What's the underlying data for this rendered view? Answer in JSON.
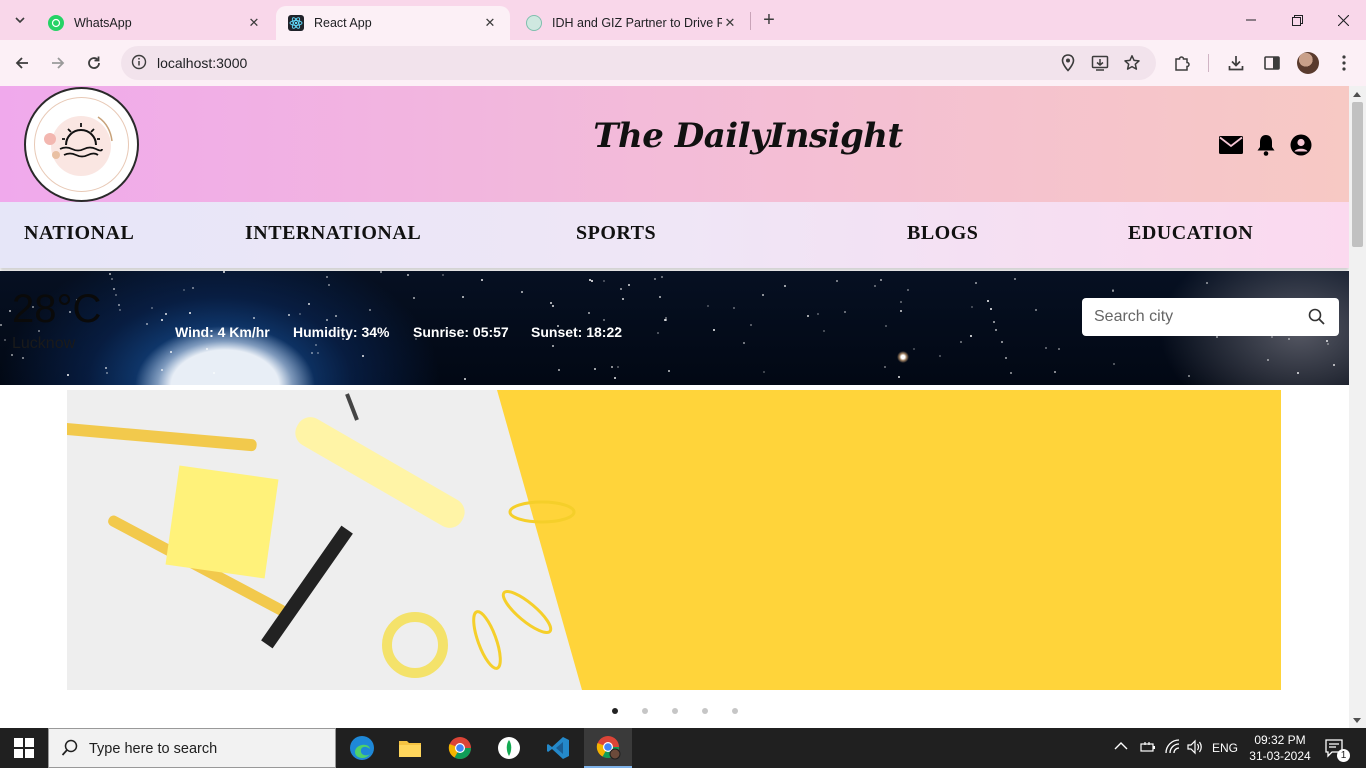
{
  "browser": {
    "tabs": [
      {
        "title": "WhatsApp",
        "active": false
      },
      {
        "title": "React App",
        "active": true
      },
      {
        "title": "IDH and GIZ Partner to Drive Re",
        "active": false
      }
    ],
    "url": "localhost:3000"
  },
  "site": {
    "title": "The DailyInsight",
    "nav": [
      "NATIONAL",
      "INTERNATIONAL",
      "SPORTS",
      "BLOGS",
      "EDUCATION"
    ]
  },
  "weather": {
    "temperature": "28°C",
    "city": "Lucknow",
    "wind": "Wind: 4 Km/hr",
    "humidity": "Humidity: 34%",
    "sunrise": "Sunrise: 05:57",
    "sunset": "Sunset: 18:22",
    "search_placeholder": "Search city"
  },
  "carousel": {
    "slide_count": 5,
    "active_index": 0
  },
  "taskbar": {
    "search_placeholder": "Type here to search",
    "language": "ENG",
    "time": "09:32 PM",
    "date": "31-03-2024",
    "notification_count": "1"
  },
  "colors": {
    "header_gradient_start": "#f0a9ec",
    "header_gradient_end": "#f7c9c4",
    "banner_yellow": "#ffd23b",
    "taskbar": "#202020"
  }
}
